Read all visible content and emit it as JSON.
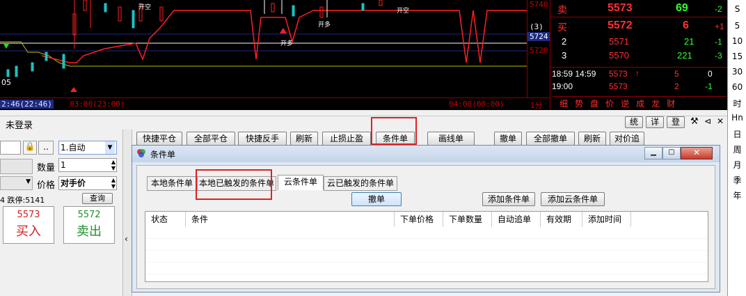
{
  "price_axis": [
    "5740",
    "(3)",
    "5724",
    "5720"
  ],
  "time_axis": [
    "2:46(22:46)",
    "03:00(23:00)",
    "04:00(00:00)",
    "1分"
  ],
  "chart_labels": {
    "left_value": "05",
    "tag": "开空",
    "tag2": "开多"
  },
  "quote": {
    "rows": [
      {
        "label": "卖",
        "price": "5573",
        "vol": "69",
        "chg": "-2",
        "price_color": "#ff3030",
        "vol_color": "#30ff30"
      },
      {
        "label": "买",
        "price": "5572",
        "vol": "6",
        "chg": "+1",
        "price_color": "#ff3030",
        "vol_color": "#ff3030"
      },
      {
        "label": "2",
        "price": "5571",
        "vol": "21",
        "chg": "-1",
        "price_color": "#ff3030",
        "vol_color": "#30ff30"
      },
      {
        "label": "3",
        "price": "5570",
        "vol": "221",
        "chg": "-3",
        "price_color": "#ff3030",
        "vol_color": "#30ff30"
      }
    ],
    "ticks": [
      {
        "time": "18:59 14:59",
        "price": "5573",
        "arrow": "↑",
        "vol": "5",
        "chg": "0"
      },
      {
        "time": "19:00",
        "price": "5573",
        "arrow": "",
        "vol": "2",
        "chg": "-1"
      }
    ],
    "tabs": [
      "细",
      "势",
      "盘",
      "价",
      "逆",
      "成",
      "龙",
      "财"
    ]
  },
  "sidebar": [
    "S",
    "5",
    "10",
    "15",
    "30",
    "60",
    "时",
    "Hn",
    "日",
    "周",
    "月",
    "季",
    "年"
  ],
  "login_status": "未登录",
  "toolbar": {
    "buttons": [
      "快捷平仓",
      "全部平仓",
      "快捷反手",
      "刷新",
      "止损止盈",
      "条件单",
      "画线单",
      "撤单",
      "全部撤单",
      "刷新",
      "对价追"
    ],
    "right_buttons": [
      "统",
      "详",
      "登"
    ]
  },
  "order_form": {
    "mode": "1.自动",
    "qty_label": "数量",
    "qty": "1",
    "price_label": "价格",
    "price_type": "对手价",
    "limits": "4 跌停:5141",
    "query": "查询",
    "buy_price": "5573",
    "buy_label": "买入",
    "sell_price": "5572",
    "sell_label": "卖出"
  },
  "dialog": {
    "title": "条件单",
    "tabs": [
      "本地条件单",
      "本地已触发的条件单",
      "云条件单",
      "云已触发的条件单"
    ],
    "cancel_btn": "撤单",
    "add_btn": "添加条件单",
    "add_cloud_btn": "添加云条件单",
    "columns": [
      "状态",
      "条件",
      "下单价格",
      "下单数量",
      "自动追单",
      "有效期",
      "添加时间"
    ]
  },
  "colors": {
    "accent_red": "#e02020",
    "chart_red": "#ff2020",
    "chart_green": "#20e020"
  }
}
